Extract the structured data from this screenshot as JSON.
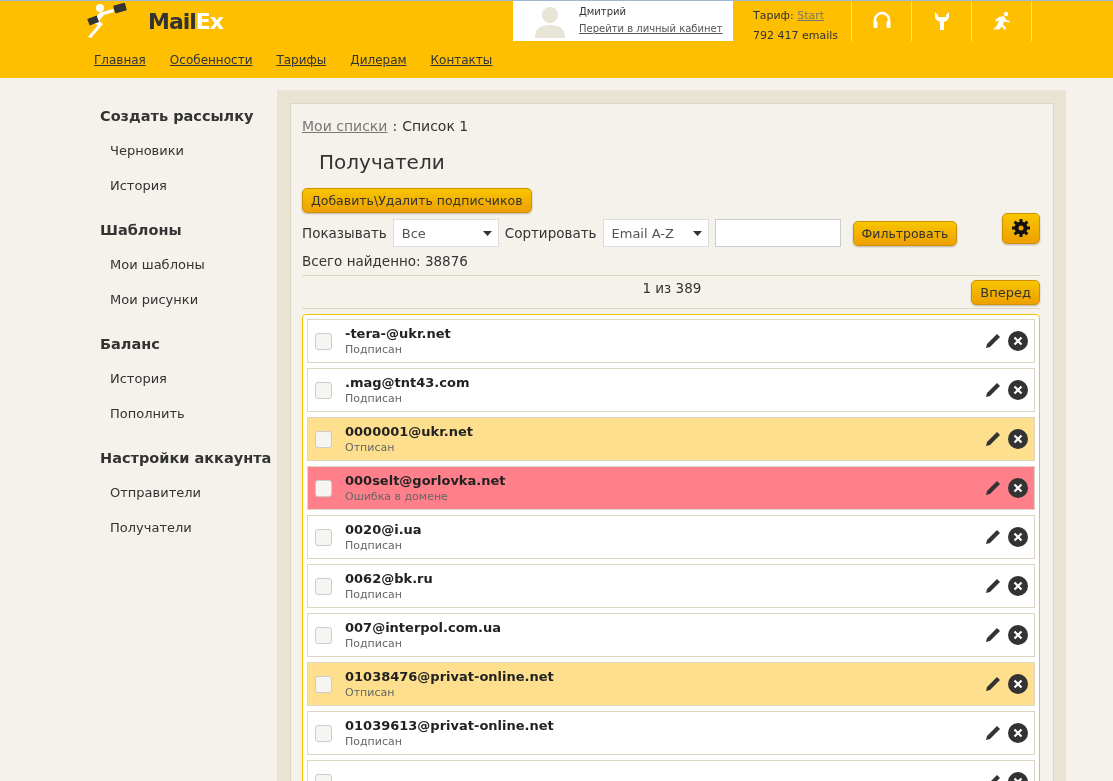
{
  "header": {
    "logo": {
      "part_1": "Mail",
      "part_2": "Ex"
    },
    "user": {
      "name": "Дмитрий",
      "link": "Перейти в личный кабинет"
    },
    "tariff": {
      "label": "Тариф:",
      "plan": "Start",
      "emails": "792 417 emails"
    },
    "nav": [
      "Главная",
      "Особенности",
      "Тарифы",
      "Дилерам",
      "Контакты"
    ]
  },
  "sidebar": [
    {
      "title": "Создать рассылку",
      "items": [
        "Черновики",
        "История"
      ]
    },
    {
      "title": "Шаблоны",
      "items": [
        "Мои шаблоны",
        "Мои рисунки"
      ]
    },
    {
      "title": "Баланс",
      "items": [
        "История",
        "Пополнить"
      ]
    },
    {
      "title": "Настройки аккаунта",
      "items": [
        "Отправители",
        "Получатели"
      ]
    }
  ],
  "breadcrumb": {
    "link": "Мои списки",
    "separator": ":",
    "current": "Список 1"
  },
  "heading": "Получатели",
  "add_button": "Добавить\\Удалить подписчиков",
  "filters": {
    "show_label": "Показывать",
    "show_value": "Все",
    "sort_label": "Сортировать",
    "sort_value": "Email A-Z",
    "filter_button": "Фильтровать"
  },
  "total": "Всего найденно: 38876",
  "pager": {
    "page": "1 из 389",
    "next": "Вперед"
  },
  "rows": [
    {
      "email": "-tera-@ukr.net",
      "status": "Подписан",
      "kind": "subscribed",
      "checked": false
    },
    {
      "email": ".mag@tnt43.com",
      "status": "Подписан",
      "kind": "subscribed",
      "checked": false
    },
    {
      "email": "0000001@ukr.net",
      "status": "Отписан",
      "kind": "unsubscribed",
      "checked": false
    },
    {
      "email": "000selt@gorlovka.net",
      "status": "Ошибка в домене",
      "kind": "error",
      "checked": false
    },
    {
      "email": "0020@i.ua",
      "status": "Подписан",
      "kind": "subscribed",
      "checked": false
    },
    {
      "email": "0062@bk.ru",
      "status": "Подписан",
      "kind": "subscribed",
      "checked": false
    },
    {
      "email": "007@interpol.com.ua",
      "status": "Подписан",
      "kind": "subscribed",
      "checked": false
    },
    {
      "email": "01038476@privat-online.net",
      "status": "Отписан",
      "kind": "unsubscribed",
      "checked": false
    },
    {
      "email": "01039613@privat-online.net",
      "status": "Подписан",
      "kind": "subscribed",
      "checked": false
    },
    {
      "kind": "subscribed",
      "checked": false
    }
  ]
}
